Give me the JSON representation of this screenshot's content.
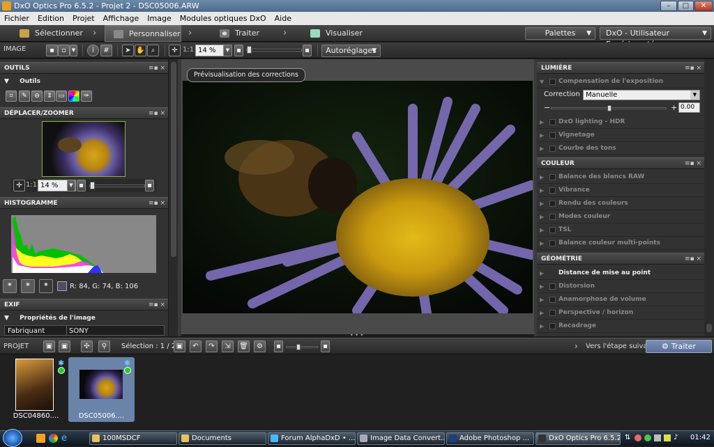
{
  "window": {
    "title": "DxO Optics Pro 6.5.2 - Projet 2 - DSC05006.ARW"
  },
  "menu": [
    "Fichier",
    "Edition",
    "Projet",
    "Affichage",
    "Image",
    "Modules optiques DxO",
    "Aide"
  ],
  "steps": {
    "select": "Sélectionner",
    "customize": "Personnaliser",
    "process": "Traiter",
    "view": "Visualiser"
  },
  "top_right": {
    "palettes": "Palettes",
    "workspace": "DxO - Utilisateur Expérimenté"
  },
  "toolbar": {
    "image_label": "IMAGE",
    "one_to_one": "1:1",
    "zoom": "14 %",
    "autoreglages": "Autoréglages"
  },
  "left": {
    "outils_title": "OUTILS",
    "outils_sub": "Outils",
    "nav_title": "DÉPLACER/ZOOMER",
    "nav_one_to_one": "1:1",
    "nav_zoom": "14 %",
    "histo_title": "HISTOGRAMME",
    "rgb": "R: 84, G: 74, B: 106",
    "exif_title": "EXIF",
    "exif_sub": "Propriétés de l'image",
    "exif_row": {
      "key": "Fabriquant",
      "value": "SONY"
    }
  },
  "viewer": {
    "preview_label": "Prévisualisation des corrections",
    "dots": "• • •"
  },
  "right": {
    "lumiere": {
      "title": "LUMIÈRE",
      "exposure": "Compensation de l'exposition",
      "correction_label": "Correction :",
      "correction_value": "Manuelle",
      "minus": "−",
      "plus": "+",
      "value": "0.00",
      "items": [
        "DxO lighting - HDR",
        "Vignetage",
        "Courbe des tons"
      ]
    },
    "couleur": {
      "title": "COULEUR",
      "items": [
        "Balance des blancs RAW",
        "Vibrance",
        "Rendu des couleurs",
        "Modes couleur",
        "TSL",
        "Balance couleur multi-points"
      ]
    },
    "geometrie": {
      "title": "GÉOMÉTRIE",
      "items": [
        "Distance de mise au point",
        "Distorsion",
        "Anamorphose de volume",
        "Perspective / horizon",
        "Recadrage"
      ]
    }
  },
  "project": {
    "label": "PROJET",
    "selection": "Sélection : 1 / 2",
    "next": "Vers l'étape suivante",
    "process_btn": "Traiter"
  },
  "filmstrip": [
    {
      "name": "DSC04860...."
    },
    {
      "name": "DSC05006...."
    }
  ],
  "taskbar": {
    "items": [
      "100MSDCF",
      "Documents",
      "Forum AlphaDxD • ...",
      "Image Data Convert...",
      "Adobe Photoshop ...",
      "DxO Optics Pro 6.5.2..."
    ],
    "clock": "01:42"
  },
  "colors": {
    "accent": "#6a83a8",
    "panel": "#323232",
    "histogram_bg": "#888888"
  }
}
